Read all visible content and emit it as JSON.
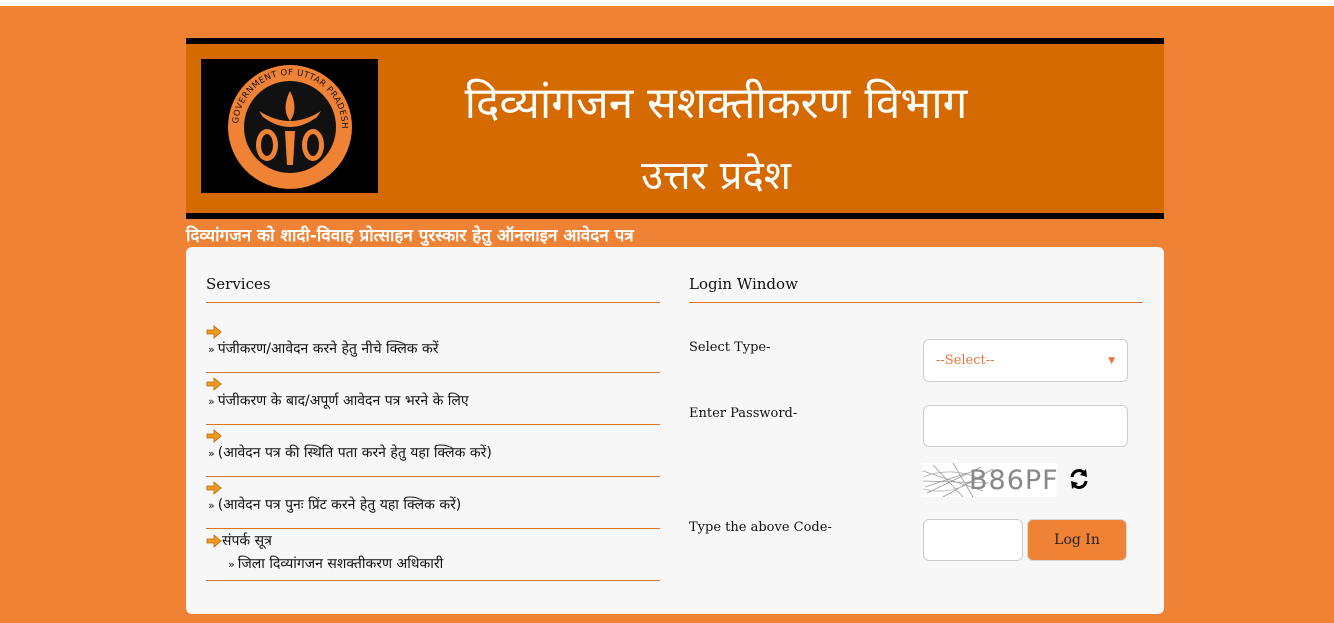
{
  "banner": {
    "title": "दिव्यांगजन सशक्तीकरण विभाग",
    "subtitle": "उत्तर प्रदेश",
    "emblem_text": "GOVERNMENT OF UTTAR PRADESH"
  },
  "page_heading": "दिव्यांगजन को शादी-विवाह प्रोत्साहन पुरस्कार हेतु ऑनलाइन आवेदन पत्र",
  "services": {
    "title": "Services",
    "items": [
      {
        "label": "पंजीकरण/आवेदन करने हेतु नीचे क्लिक करें"
      },
      {
        "label": "पंजीकरण के बाद/अपूर्ण आवेदन पत्र भरने के लिए"
      },
      {
        "label": "(आवेदन पत्र की स्थिति पता करने हेतु यहा क्लिक करें)"
      },
      {
        "label": "(आवेदन पत्र पुनः प्रिंट करने हेतु यहा क्लिक करें)"
      }
    ],
    "contact": {
      "heading": "संपर्क सूत्र",
      "link": "जिला दिव्यांगजन सशक्तीकरण अधिकारी"
    },
    "bullet_mark": "»"
  },
  "login": {
    "title": "Login Window",
    "select_type_label": "Select Type-",
    "select_value": "--Select--",
    "password_label": "Enter Password-",
    "password_value": "",
    "captcha_text": "B86PF",
    "code_label": "Type the above Code-",
    "code_value": "",
    "login_button": "Log In"
  },
  "colors": {
    "background": "#ef8235",
    "banner": "#d46a00",
    "accent": "#e8743a",
    "panel": "#f7f7f7"
  }
}
